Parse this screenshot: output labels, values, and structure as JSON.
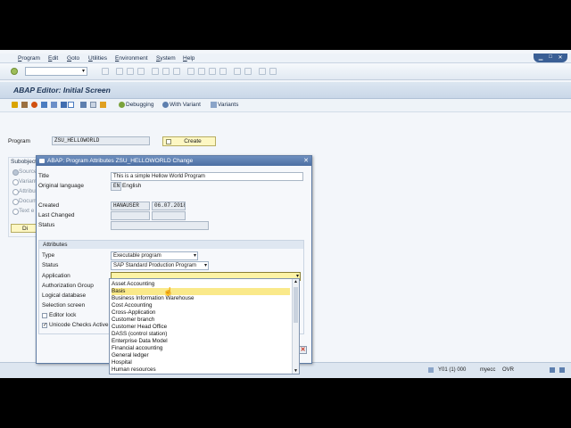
{
  "menu": [
    "Program",
    "Edit",
    "Goto",
    "Utilities",
    "Environment",
    "System",
    "Help"
  ],
  "screen_title": "ABAP Editor: Initial Screen",
  "app_toolbar": {
    "debugging": "Debugging",
    "with_variant": "With Variant",
    "variants": "Variants"
  },
  "program": {
    "label": "Program",
    "value": "ZSU_HELLOWORLD",
    "create_button": "Create"
  },
  "subobjects": {
    "label": "Subobject",
    "items": [
      "Source",
      "Variant",
      "Attribut",
      "Docum",
      "Text e"
    ],
    "display_button": "Di"
  },
  "dialog": {
    "title": "ABAP: Program Attributes ZSU_HELLOWORLD Change",
    "title_label": "Title",
    "title_value": "This is a simple Hellow World Program",
    "orig_lang_label": "Original language",
    "orig_lang_code": "EN",
    "orig_lang_name": "English",
    "created_label": "Created",
    "created_by": "HANAUSER",
    "created_date": "06.07.2018",
    "last_changed_label": "Last Changed",
    "status_label": "Status",
    "attributes_header": "Attributes",
    "type_label": "Type",
    "type_value": "Executable program",
    "status_attr_label": "Status",
    "status_attr_value": "SAP Standard Production Program",
    "application_label": "Application",
    "auth_group_label": "Authorization Group",
    "logical_db_label": "Logical database",
    "selection_screen_label": "Selection screen",
    "editor_lock_label": "Editor lock",
    "unicode_label": "Unicode Checks Active",
    "editor_lock_checked": false,
    "unicode_checked": true
  },
  "application_list": {
    "selected_index": 1,
    "items": [
      "Asset Accounting",
      "Basis",
      "Business Information Warehouse",
      "Cost Accounting",
      "Cross-Application",
      "Customer branch",
      "Customer Head Office",
      "DASS (control station)",
      "Enterprise Data Model",
      "Financial accounting",
      "General ledger",
      "Hospital",
      "Human resources"
    ]
  },
  "status_bar": {
    "system": "Y01 (1) 000",
    "server": "myecc",
    "mode": "OVR"
  },
  "colors": {
    "screen_bg": "#f3f6fa",
    "dialog_title": "#4c6fa2",
    "selection": "#fae98a",
    "button_yellow": "#fdf7c3"
  }
}
